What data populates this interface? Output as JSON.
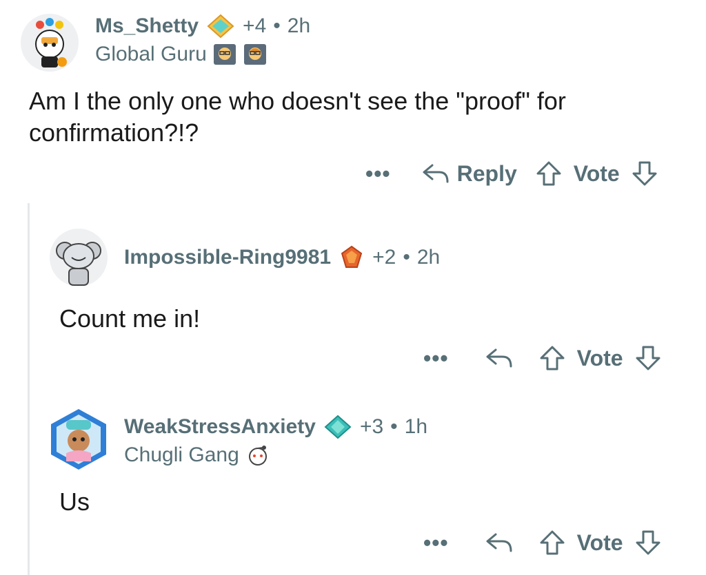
{
  "comments": [
    {
      "username": "Ms_Shetty",
      "score": "+4",
      "time": "2h",
      "flair": "Global Guru",
      "text": "Am I the only one who doesn't see the \"proof\" for confirmation?!?",
      "actions": {
        "more": "•••",
        "reply": "Reply",
        "vote": "Vote"
      }
    },
    {
      "username": "Impossible-Ring9981",
      "score": "+2",
      "time": "2h",
      "text": "Count me in!",
      "actions": {
        "more": "•••",
        "vote": "Vote"
      }
    },
    {
      "username": "WeakStressAnxiety",
      "score": "+3",
      "time": "1h",
      "flair": "Chugli Gang",
      "text": "Us",
      "actions": {
        "more": "•••",
        "vote": "Vote"
      }
    }
  ],
  "separator": "•",
  "colors": {
    "text": "#1a1a1b",
    "meta": "#576f76",
    "thread_line": "#e5e8ea"
  }
}
